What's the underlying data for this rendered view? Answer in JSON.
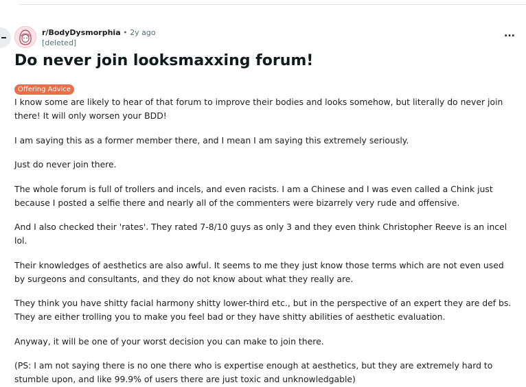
{
  "post": {
    "subreddit": "r/BodyDysmorphia",
    "separator": "•",
    "age": "2y ago",
    "author": "[deleted]",
    "more_label": "...",
    "title": "Do never join looksmaxxing forum!",
    "flair": "Offering Advice",
    "paragraphs": [
      "I know some are likely to hear of that forum to improve their bodies and looks somehow, but literally do never join there! It will only worsen your BDD!",
      "I am saying this as a former member there, and I mean I am saying this extremely seriously.",
      "Just do never join there.",
      "The whole forum is full of trollers and incels, and even racists. I am a Chinese and I was even called a Chink just because I posted a selfie there and nearly all of the commenters were bizarrely very rude and offensive.",
      "And I also checked their 'rates'. They rated 7-8/10 guys as only 3 and they even think Christopher Reeve is an incel lol.",
      "Their knowledges of aesthetics are also awful. It seems to me they just know those terms which are not even used by surgeons and consultants, and they do not know about what they really are.",
      "They think you have shitty facial harmony shitty lower-third etc., but in the perspective of an expert they are def bs. They are either trolling you to make you feel bad or they have shitty abilities of aesthetic evaluation.",
      "Anyway, it will be one of your worst decision you can make to join there.",
      "(PS: I am not saying there is no one there who is expertise enough at aesthetics, but they are extremely hard to stumble upon, and like 99.9% of users there are just toxic and unknowledgable)"
    ]
  },
  "colors": {
    "flair_bg": "#e86e4b",
    "meta_text": "#576f76"
  },
  "icons": {
    "avatar": "subreddit-avatar-icon",
    "back": "back-arrow-icon",
    "more": "overflow-menu-icon"
  }
}
